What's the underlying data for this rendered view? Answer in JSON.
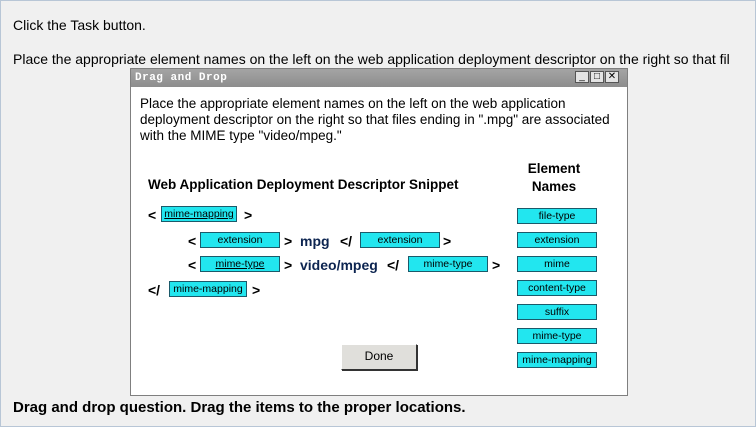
{
  "page": {
    "instruction_1": "Click the Task button.",
    "instruction_2": "Place the appropriate element names on the left on the web application deployment descriptor on the right so that fil",
    "footer": "Drag and drop question. Drag the items to the proper locations."
  },
  "dialog": {
    "title": "Drag and Drop",
    "controls": {
      "minimize": "_",
      "maximize": "□",
      "close": "✕"
    },
    "instruction": "Place the appropriate element names on the left on the web application deployment descriptor on the right so that files ending in \".mpg\" are associated with the MIME type \"video/mpeg.\"",
    "snippet_heading": "Web Application Deployment Descriptor Snippet",
    "elements_heading": "Element Names",
    "snippet": {
      "lt": "<",
      "gt": ">",
      "close_lt": "</",
      "slot_open_mapping": "mime-mapping",
      "slot_extension_open": "extension",
      "value_mpg": "mpg",
      "slot_extension_close": "extension",
      "slot_mime_type_open": "mime-type",
      "value_video": "video/mpeg",
      "slot_mime_type_close": "mime-type",
      "slot_close_mapping": "mime-mapping"
    },
    "element_names": [
      "file-type",
      "extension",
      "mime",
      "content-type",
      "suffix",
      "mime-type",
      "mime-mapping"
    ],
    "done_label": "Done"
  }
}
